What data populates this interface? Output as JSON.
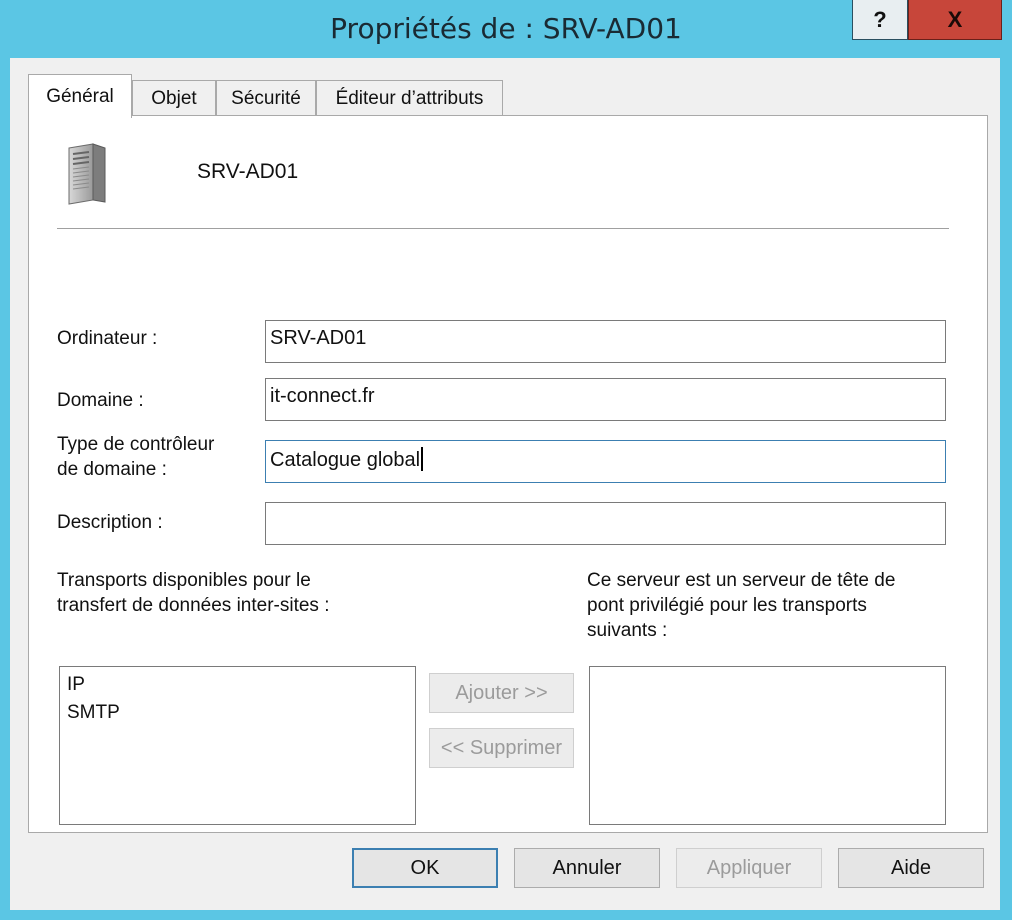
{
  "window": {
    "title": "Propriétés de : SRV-AD01",
    "help_label": "?",
    "close_label": "X"
  },
  "tabs": [
    {
      "label": "Général",
      "active": true
    },
    {
      "label": "Objet",
      "active": false
    },
    {
      "label": "Sécurité",
      "active": false
    },
    {
      "label": "Éditeur d’attributs",
      "active": false
    }
  ],
  "general": {
    "server_name": "SRV-AD01",
    "server_icon": "server-tower-icon",
    "computer_label": "Ordinateur :",
    "computer_value": "SRV-AD01",
    "domain_label": "Domaine :",
    "domain_value": "it-connect.fr",
    "dc_type_label_line1": "Type de contrôleur",
    "dc_type_label_line2": "de domaine :",
    "dc_type_value": "Catalogue global",
    "description_label": "Description :",
    "description_value": "",
    "transports_label_line1": "Transports disponibles pour le",
    "transports_label_line2": "transfert de données inter-sites :",
    "bridgehead_label_line1": "Ce serveur est un serveur de tête de",
    "bridgehead_label_line2": "pont privilégié pour les transports",
    "bridgehead_label_line3": "suivants :",
    "available_transports": [
      "IP",
      "SMTP"
    ],
    "selected_transports": [],
    "add_label": "Ajouter >>",
    "remove_label": "<< Supprimer"
  },
  "footer": {
    "ok_label": "OK",
    "cancel_label": "Annuler",
    "apply_label": "Appliquer",
    "help_label": "Aide"
  },
  "colors": {
    "title_bar": "#5bc6e4",
    "close_button": "#c7463a",
    "focus_border": "#3c7fb1"
  }
}
